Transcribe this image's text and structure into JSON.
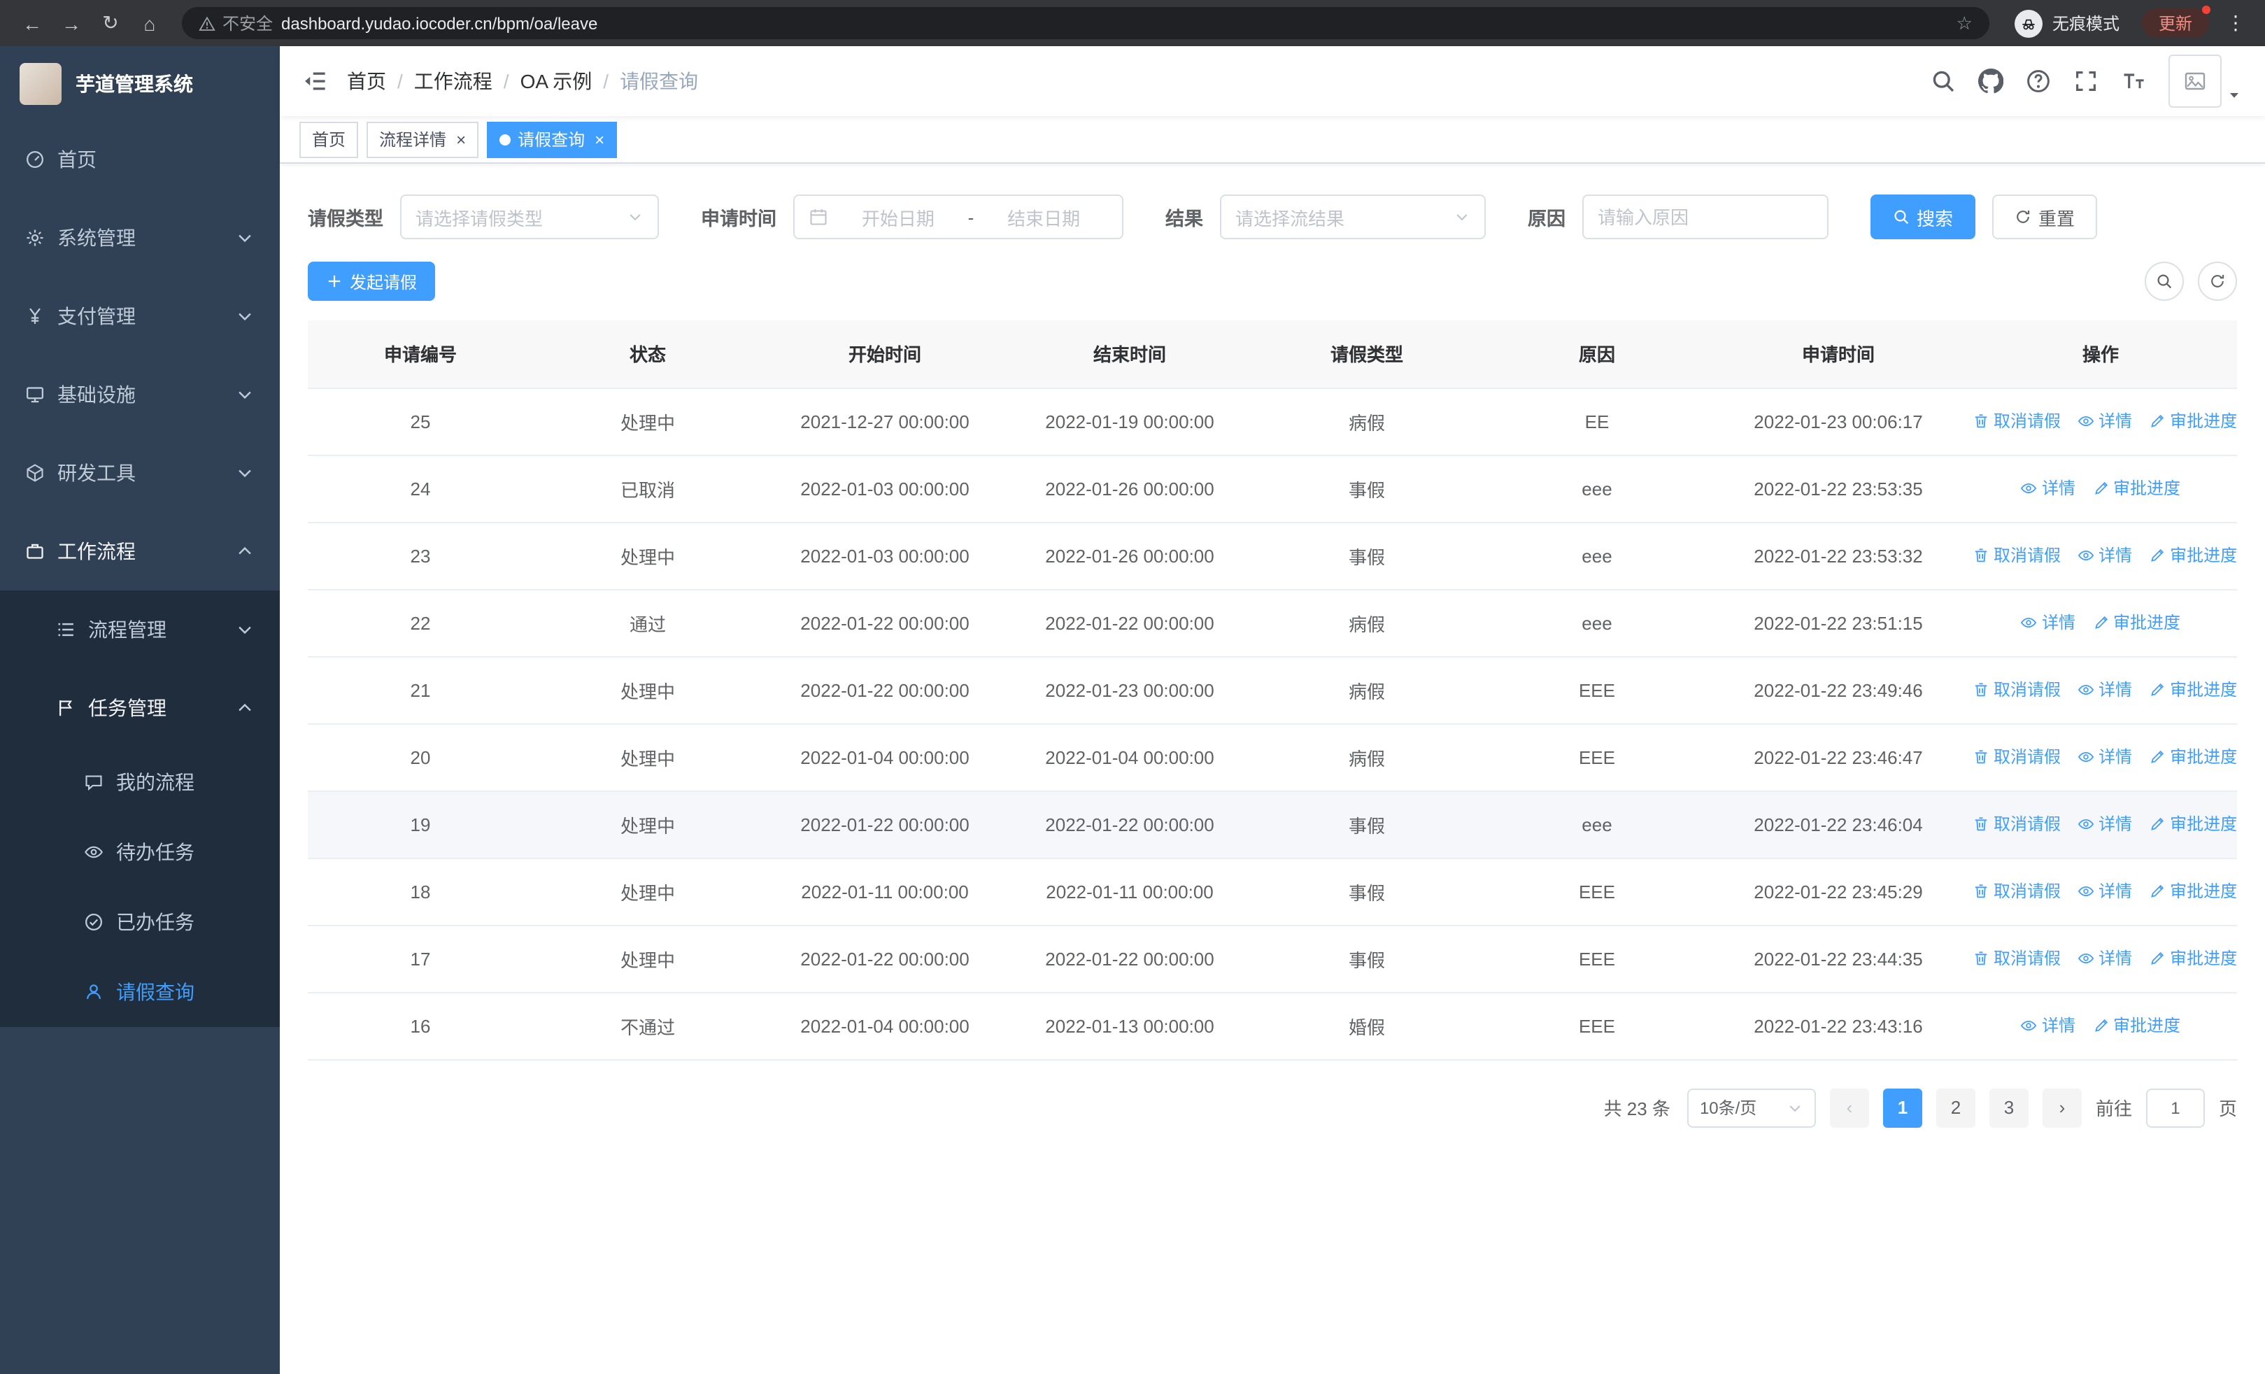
{
  "browser": {
    "security_label": "不安全",
    "url": "dashboard.yudao.iocoder.cn/bpm/oa/leave",
    "incognito_label": "无痕模式",
    "update_label": "更新",
    "glyphs": {
      "back": "←",
      "forward": "→",
      "reload": "↻",
      "home": "⌂",
      "star": "☆",
      "menu": "⋮"
    }
  },
  "sidebar": {
    "logo_title": "芋道管理系统",
    "items": [
      {
        "label": "首页"
      },
      {
        "label": "系统管理"
      },
      {
        "label": "支付管理"
      },
      {
        "label": "基础设施"
      },
      {
        "label": "研发工具"
      },
      {
        "label": "工作流程"
      },
      {
        "label": "流程管理"
      },
      {
        "label": "任务管理"
      },
      {
        "label": "我的流程"
      },
      {
        "label": "待办任务"
      },
      {
        "label": "已办任务"
      },
      {
        "label": "请假查询"
      }
    ]
  },
  "breadcrumb": {
    "separator": "/",
    "items": [
      "首页",
      "工作流程",
      "OA 示例",
      "请假查询"
    ]
  },
  "tabs": {
    "close_glyph": "×",
    "items": [
      {
        "label": "首页"
      },
      {
        "label": "流程详情"
      },
      {
        "label": "请假查询"
      }
    ]
  },
  "filters": {
    "leave_type_label": "请假类型",
    "leave_type_placeholder": "请选择请假类型",
    "apply_time_label": "申请时间",
    "start_placeholder": "开始日期",
    "range_separator": "-",
    "end_placeholder": "结束日期",
    "result_label": "结果",
    "result_placeholder": "请选择流结果",
    "reason_label": "原因",
    "reason_placeholder": "请输入原因",
    "search_label": "搜索",
    "reset_label": "重置"
  },
  "toolbar": {
    "create_label": "发起请假"
  },
  "table": {
    "columns": [
      "申请编号",
      "状态",
      "开始时间",
      "结束时间",
      "请假类型",
      "原因",
      "申请时间",
      "操作"
    ],
    "actions": {
      "cancel": "取消请假",
      "detail": "详情",
      "progress": "审批进度"
    },
    "rows": [
      {
        "id": "25",
        "status": "处理中",
        "start": "2021-12-27 00:00:00",
        "end": "2022-01-19 00:00:00",
        "type": "病假",
        "reason": "EE",
        "applied": "2022-01-23 00:06:17",
        "cancellable": true
      },
      {
        "id": "24",
        "status": "已取消",
        "start": "2022-01-03 00:00:00",
        "end": "2022-01-26 00:00:00",
        "type": "事假",
        "reason": "eee",
        "applied": "2022-01-22 23:53:35",
        "cancellable": false
      },
      {
        "id": "23",
        "status": "处理中",
        "start": "2022-01-03 00:00:00",
        "end": "2022-01-26 00:00:00",
        "type": "事假",
        "reason": "eee",
        "applied": "2022-01-22 23:53:32",
        "cancellable": true
      },
      {
        "id": "22",
        "status": "通过",
        "start": "2022-01-22 00:00:00",
        "end": "2022-01-22 00:00:00",
        "type": "病假",
        "reason": "eee",
        "applied": "2022-01-22 23:51:15",
        "cancellable": false
      },
      {
        "id": "21",
        "status": "处理中",
        "start": "2022-01-22 00:00:00",
        "end": "2022-01-23 00:00:00",
        "type": "病假",
        "reason": "EEE",
        "applied": "2022-01-22 23:49:46",
        "cancellable": true
      },
      {
        "id": "20",
        "status": "处理中",
        "start": "2022-01-04 00:00:00",
        "end": "2022-01-04 00:00:00",
        "type": "病假",
        "reason": "EEE",
        "applied": "2022-01-22 23:46:47",
        "cancellable": true
      },
      {
        "id": "19",
        "status": "处理中",
        "start": "2022-01-22 00:00:00",
        "end": "2022-01-22 00:00:00",
        "type": "事假",
        "reason": "eee",
        "applied": "2022-01-22 23:46:04",
        "cancellable": true
      },
      {
        "id": "18",
        "status": "处理中",
        "start": "2022-01-11 00:00:00",
        "end": "2022-01-11 00:00:00",
        "type": "事假",
        "reason": "EEE",
        "applied": "2022-01-22 23:45:29",
        "cancellable": true
      },
      {
        "id": "17",
        "status": "处理中",
        "start": "2022-01-22 00:00:00",
        "end": "2022-01-22 00:00:00",
        "type": "事假",
        "reason": "EEE",
        "applied": "2022-01-22 23:44:35",
        "cancellable": true
      },
      {
        "id": "16",
        "status": "不通过",
        "start": "2022-01-04 00:00:00",
        "end": "2022-01-13 00:00:00",
        "type": "婚假",
        "reason": "EEE",
        "applied": "2022-01-22 23:43:16",
        "cancellable": false
      }
    ]
  },
  "pagination": {
    "total_text": "共 23 条",
    "page_size_text": "10条/页",
    "prev_glyph": "‹",
    "next_glyph": "›",
    "pages": [
      "1",
      "2",
      "3"
    ],
    "active_page": "1",
    "goto_label": "前往",
    "goto_value": "1",
    "unit_label": "页"
  },
  "colors": {
    "accent": "#409eff",
    "sidebar_bg": "#304156",
    "submenu_bg": "#1f2d3d",
    "chrome_bg": "#35363a"
  }
}
